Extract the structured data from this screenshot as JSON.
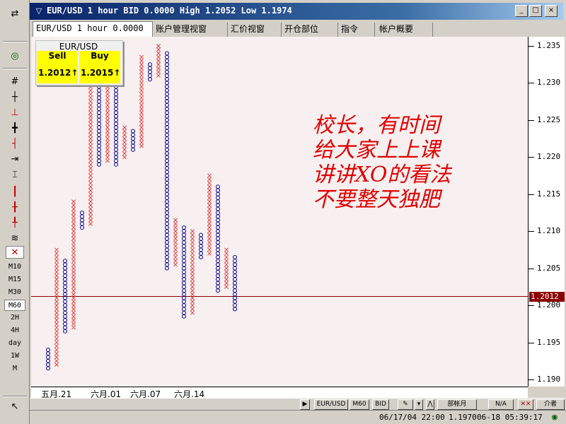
{
  "window": {
    "title": "EUR/USD 1 hour BID 0.0000  High 1.2052 Low 1.1974",
    "minimize_glyph": "_",
    "maximize_glyph": "□",
    "close_glyph": "×"
  },
  "tabs": [
    {
      "label": "EUR/USD 1 hour 0.0000",
      "active": true
    },
    {
      "label": "账户管理视窗",
      "active": false
    },
    {
      "label": "汇价视窗",
      "active": false
    },
    {
      "label": "开仓部位",
      "active": false
    },
    {
      "label": "指令",
      "active": false
    },
    {
      "label": "帐户概要",
      "active": false
    }
  ],
  "quote": {
    "symbol": "EUR/USD",
    "sell_label": "Sell",
    "buy_label": "Buy",
    "sell_value": "1.2012",
    "buy_value": "1.2015",
    "sell_arrow": "↑",
    "buy_arrow": "↑",
    "box_color": "#ffff00"
  },
  "note": {
    "lines": [
      "校长，有时间",
      "给大家上上课",
      "讲讲XO的看法",
      "不要整天独肥"
    ],
    "color": "#e00000"
  },
  "price_axis": {
    "ticks": [
      "1.235",
      "1.230",
      "1.225",
      "1.220",
      "1.215",
      "1.210",
      "1.205",
      "1.200",
      "1.195",
      "1.190"
    ],
    "current": "1.2012",
    "current_color": "#8b0000"
  },
  "date_axis": {
    "labels": [
      "五月.21",
      "六月.01",
      "六月.07",
      "六月.14"
    ]
  },
  "timeframes": [
    "M10",
    "M15",
    "M30",
    "M60",
    "2H",
    "4H",
    "day",
    "1W",
    "M"
  ],
  "active_timeframe": "M60",
  "bottom_toolbar": {
    "symbol": "EUR/USD",
    "period": "M60",
    "side": "BID",
    "account": "部帐月",
    "na": "N/A",
    "other": "介者"
  },
  "status": {
    "date": "06/17/04 22:00",
    "price": "1.1970",
    "clock": "06-18 05:39:17"
  },
  "chart_data": {
    "type": "point-and-figure",
    "box_size": 0.0005,
    "ylim": [
      1.19,
      1.235
    ],
    "x_color": "#e04040",
    "o_color": "#00008b",
    "current_price_line": 1.2012,
    "columns": [
      {
        "type": "O",
        "high": 1.194,
        "low": 1.1915
      },
      {
        "type": "X",
        "high": 1.2075,
        "low": 1.192
      },
      {
        "type": "O",
        "high": 1.206,
        "low": 1.1965
      },
      {
        "type": "X",
        "high": 1.214,
        "low": 1.197
      },
      {
        "type": "O",
        "high": 1.2125,
        "low": 1.2105
      },
      {
        "type": "X",
        "high": 1.2325,
        "low": 1.211
      },
      {
        "type": "O",
        "high": 1.2315,
        "low": 1.219
      },
      {
        "type": "X",
        "high": 1.233,
        "low": 1.2195
      },
      {
        "type": "O",
        "high": 1.2295,
        "low": 1.219
      },
      {
        "type": "X",
        "high": 1.224,
        "low": 1.22
      },
      {
        "type": "O",
        "high": 1.2235,
        "low": 1.221
      },
      {
        "type": "X",
        "high": 1.2335,
        "low": 1.2215
      },
      {
        "type": "O",
        "high": 1.2325,
        "low": 1.2305
      },
      {
        "type": "X",
        "high": 1.235,
        "low": 1.231
      },
      {
        "type": "O",
        "high": 1.234,
        "low": 1.205
      },
      {
        "type": "X",
        "high": 1.2115,
        "low": 1.2055
      },
      {
        "type": "O",
        "high": 1.2105,
        "low": 1.1985
      },
      {
        "type": "X",
        "high": 1.21,
        "low": 1.199
      },
      {
        "type": "O",
        "high": 1.2095,
        "low": 1.2065
      },
      {
        "type": "X",
        "high": 1.2175,
        "low": 1.207
      },
      {
        "type": "O",
        "high": 1.216,
        "low": 1.202
      },
      {
        "type": "X",
        "high": 1.2075,
        "low": 1.2025
      },
      {
        "type": "O",
        "high": 1.2065,
        "low": 1.1995
      }
    ]
  }
}
